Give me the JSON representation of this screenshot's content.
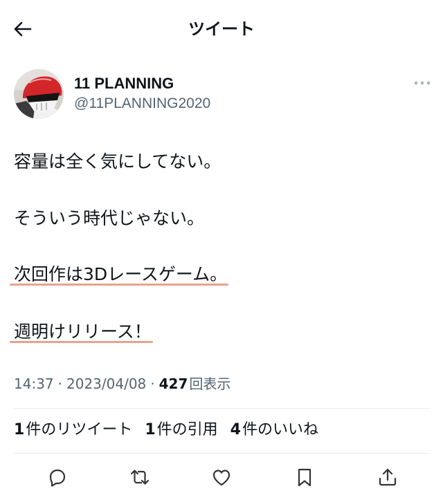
{
  "header": {
    "back_icon": "arrow-left-icon",
    "title": "ツイート"
  },
  "tweet": {
    "author": {
      "avatar_icon": "red-helmet-avatar",
      "name": "11 PLANNING",
      "handle": "@11PLANNING2020"
    },
    "more_icon": "more-horizontal-icon",
    "lines": [
      {
        "text": "容量は全く気にしてない。",
        "underlined": false
      },
      {
        "text": "そういう時代じゃない。",
        "underlined": false
      },
      {
        "text": "次回作は3Dレースゲーム。",
        "underlined": true
      },
      {
        "text": "週明けリリース！",
        "underlined": true
      }
    ],
    "meta": {
      "time": "14:37",
      "separator": "·",
      "date": "2023/04/08",
      "views_count": "427",
      "views_label": "回表示"
    },
    "stats": {
      "retweets": {
        "count": "1",
        "label": "件のリツイート"
      },
      "quotes": {
        "count": "1",
        "label": "件の引用"
      },
      "likes": {
        "count": "4",
        "label": "件のいいね"
      }
    }
  },
  "actions": [
    {
      "name": "reply",
      "icon": "reply-icon"
    },
    {
      "name": "retweet",
      "icon": "retweet-icon"
    },
    {
      "name": "like",
      "icon": "heart-icon"
    },
    {
      "name": "bookmark",
      "icon": "bookmark-icon"
    },
    {
      "name": "share",
      "icon": "share-icon"
    }
  ],
  "colors": {
    "text_primary": "#0f1419",
    "text_secondary": "#536471",
    "annotation_underline": "#e9a18f",
    "divider": "#e6ecf0"
  }
}
